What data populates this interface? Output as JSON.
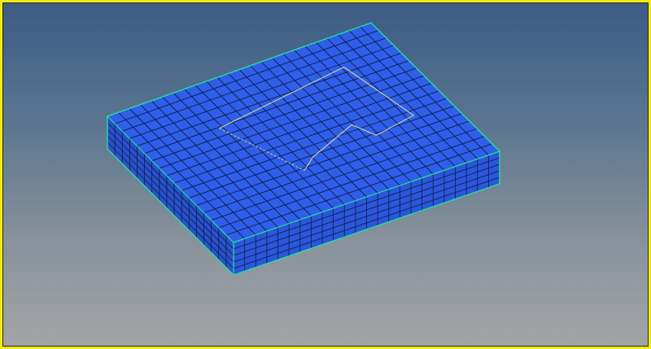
{
  "viewport": {
    "background_top": "#3b5b85",
    "background_bottom": "#a4a4a6",
    "frame_color": "#f2ea17"
  },
  "model": {
    "type": "hexahedral-mesh-slab",
    "face_color": "#2f5fe8",
    "side_color_a": "#2b56d8",
    "side_color_b": "#2a52c9",
    "mesh_line_color": "#0b1a55",
    "outline_color": "#22e0a0",
    "feature_line_color": "#d8d49a",
    "grid_u": 24,
    "grid_v": 17,
    "thickness_layers": 5
  }
}
